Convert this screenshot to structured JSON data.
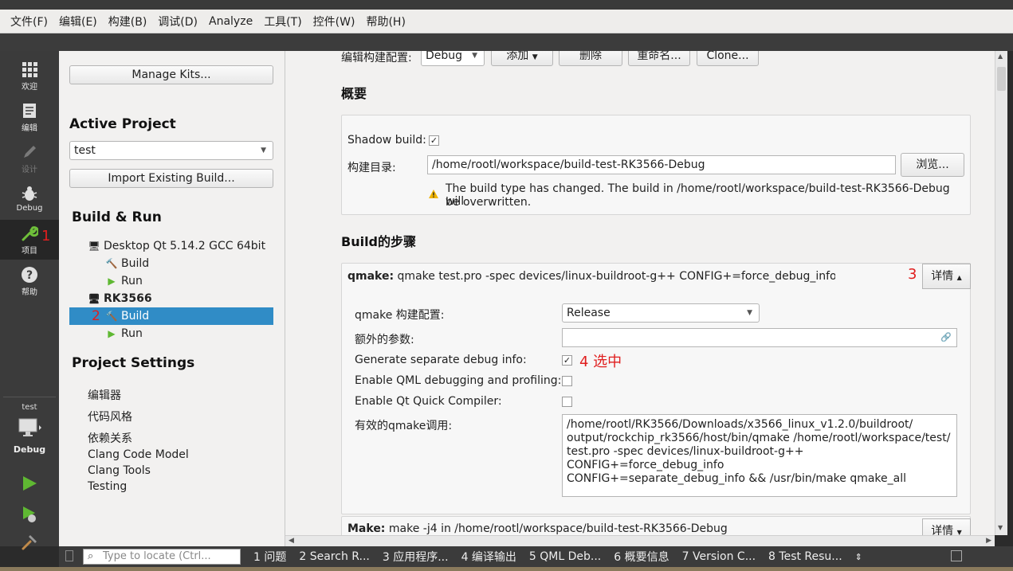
{
  "menu": [
    "文件(F)",
    "编辑(E)",
    "构建(B)",
    "调试(D)",
    "Analyze",
    "工具(T)",
    "控件(W)",
    "帮助(H)"
  ],
  "modes": [
    {
      "label": "欢迎",
      "icon": "grid-icon"
    },
    {
      "label": "编辑",
      "icon": "edit-doc-icon"
    },
    {
      "label": "设计",
      "icon": "pencil-icon"
    },
    {
      "label": "Debug",
      "icon": "bug-icon"
    },
    {
      "label": "项目",
      "icon": "wrench-icon"
    },
    {
      "label": "帮助",
      "icon": "help-icon"
    }
  ],
  "annotations": {
    "a1": "1",
    "a2": "2",
    "a3": "3",
    "a4": "4 选中"
  },
  "target": {
    "project": "test",
    "mode": "Debug"
  },
  "left": {
    "manage_kits": "Manage Kits...",
    "active_project_title": "Active Project",
    "active_project": "test",
    "import_build": "Import Existing Build...",
    "build_run_title": "Build & Run",
    "kits": [
      {
        "name": "Desktop Qt 5.14.2 GCC 64bit",
        "build": "Build",
        "run": "Run"
      },
      {
        "name": "RK3566",
        "build": "Build",
        "run": "Run"
      }
    ],
    "project_settings_title": "Project Settings",
    "settings": [
      "编辑器",
      "代码风格",
      "依赖关系",
      "Clang Code Model",
      "Clang Tools",
      "Testing"
    ]
  },
  "main": {
    "edit_config_label": "编辑构建配置:",
    "edit_config_value": "Debug",
    "add_btn": "添加",
    "delete_btn": "删除",
    "rename_btn": "重命名...",
    "clone_btn": "Clone...",
    "overview_title": "概要",
    "shadow_build_label": "Shadow build:",
    "build_dir_label": "构建目录:",
    "build_dir_value": "/home/rootl/workspace/build-test-RK3566-Debug",
    "browse_btn": "浏览...",
    "warning_line1": "The build type has changed. The build in /home/rootl/workspace/build-test-RK3566-Debug will",
    "warning_line2": "be overwritten.",
    "steps_title": "Build的步骤",
    "qmake_step_bold": "qmake:",
    "qmake_step_text": "qmake test.pro -spec devices/linux-buildroot-g++ CONFIG+=force_debug_info CON",
    "details_btn": "详情",
    "qmake_config_label": "qmake 构建配置:",
    "qmake_config_value": "Release",
    "extra_args_label": "额外的参数:",
    "separate_debug_label": "Generate separate debug info:",
    "qml_debug_label": "Enable QML debugging and profiling:",
    "quick_compiler_label": "Enable Qt Quick Compiler:",
    "effective_label": "有效的qmake调用:",
    "effective_lines": [
      "/home/rootl/RK3566/Downloads/x3566_linux_v1.2.0/buildroot/",
      "output/rockchip_rk3566/host/bin/qmake /home/rootl/workspace/test/",
      "test.pro -spec devices/linux-buildroot-g++ CONFIG+=force_debug_info",
      "CONFIG+=separate_debug_info && /usr/bin/make qmake_all"
    ],
    "make_step_bold": "Make:",
    "make_step_text": "make -j4 in /home/rootl/workspace/build-test-RK3566-Debug"
  },
  "status": {
    "locate_placeholder": "Type to locate (Ctrl...",
    "tabs": [
      "1 问题",
      "2 Search R...",
      "3 应用程序...",
      "4 编译输出",
      "5 QML Deb...",
      "6 概要信息",
      "7 Version C...",
      "8 Test Resu..."
    ]
  },
  "colors": {
    "accent": "#308cc6",
    "annotation": "#e01e1e",
    "modebar": "#3b3b3b"
  }
}
